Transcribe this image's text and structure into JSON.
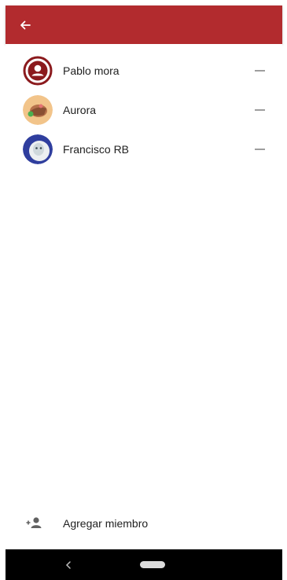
{
  "toolbar": {
    "back_icon": "arrow-left-icon",
    "color": "#b22b2e"
  },
  "members": [
    {
      "name": "Pablo mora",
      "avatar": "default-user-avatar",
      "action_icon": "minus-icon"
    },
    {
      "name": "Aurora",
      "avatar": "photo-avatar",
      "action_icon": "minus-icon"
    },
    {
      "name": "Francisco RB",
      "avatar": "photo-avatar",
      "action_icon": "minus-icon"
    }
  ],
  "add_member": {
    "label": "Agregar miembro",
    "icon": "person-add-icon"
  },
  "navbar": {
    "back_icon": "chevron-left-icon",
    "home_icon": "home-pill-icon"
  }
}
